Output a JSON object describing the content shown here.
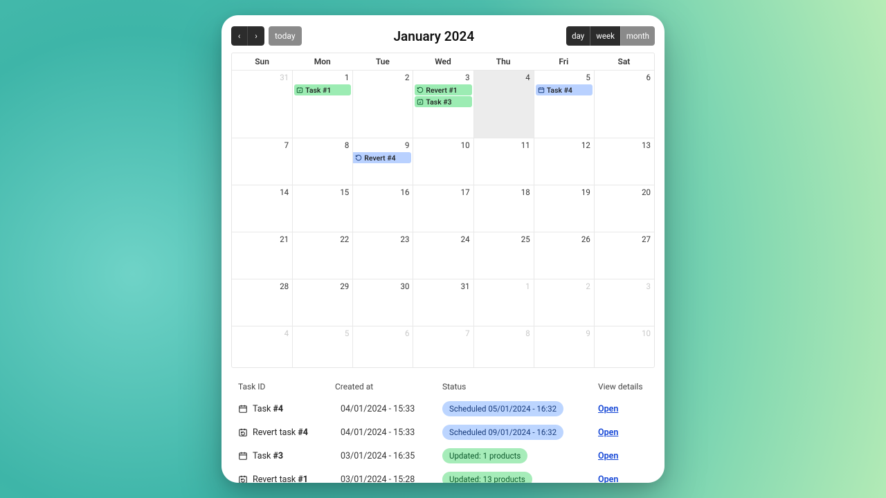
{
  "toolbar": {
    "today": "today",
    "title": "January 2024",
    "views": {
      "day": "day",
      "week": "week",
      "month": "month"
    }
  },
  "dow": [
    "Sun",
    "Mon",
    "Tue",
    "Wed",
    "Thu",
    "Fri",
    "Sat"
  ],
  "events": {
    "task1": "Task #1",
    "revert1": "Revert #1",
    "task3": "Task #3",
    "task4": "Task #4",
    "revert4": "Revert #4"
  },
  "days": {
    "r0": [
      "31",
      "1",
      "2",
      "3",
      "4",
      "5",
      "6"
    ],
    "r1": [
      "7",
      "8",
      "9",
      "10",
      "11",
      "12",
      "13"
    ],
    "r2": [
      "14",
      "15",
      "16",
      "17",
      "18",
      "19",
      "20"
    ],
    "r3": [
      "21",
      "22",
      "23",
      "24",
      "25",
      "26",
      "27"
    ],
    "r4": [
      "28",
      "29",
      "30",
      "31",
      "1",
      "2",
      "3"
    ],
    "r5": [
      "4",
      "5",
      "6",
      "7",
      "8",
      "9",
      "10"
    ]
  },
  "table": {
    "headers": {
      "id": "Task ID",
      "created": "Created at",
      "status": "Status",
      "details": "View details"
    },
    "open": "Open",
    "rows": [
      {
        "label_a": "Task ",
        "label_b": "#4",
        "icon": "cal",
        "created": "04/01/2024 - 15:33",
        "status": "Scheduled 05/01/2024 - 16:32",
        "pill": "blue"
      },
      {
        "label_a": "Revert task ",
        "label_b": "#4",
        "icon": "revert",
        "created": "04/01/2024 - 15:33",
        "status": "Scheduled 09/01/2024 - 16:32",
        "pill": "blue"
      },
      {
        "label_a": "Task ",
        "label_b": "#3",
        "icon": "cal",
        "created": "03/01/2024 - 16:35",
        "status": "Updated: 1 products",
        "pill": "green"
      },
      {
        "label_a": "Revert task ",
        "label_b": "#1",
        "icon": "revert",
        "created": "03/01/2024 - 15:28",
        "status": "Updated: 13 products",
        "pill": "green"
      }
    ]
  }
}
